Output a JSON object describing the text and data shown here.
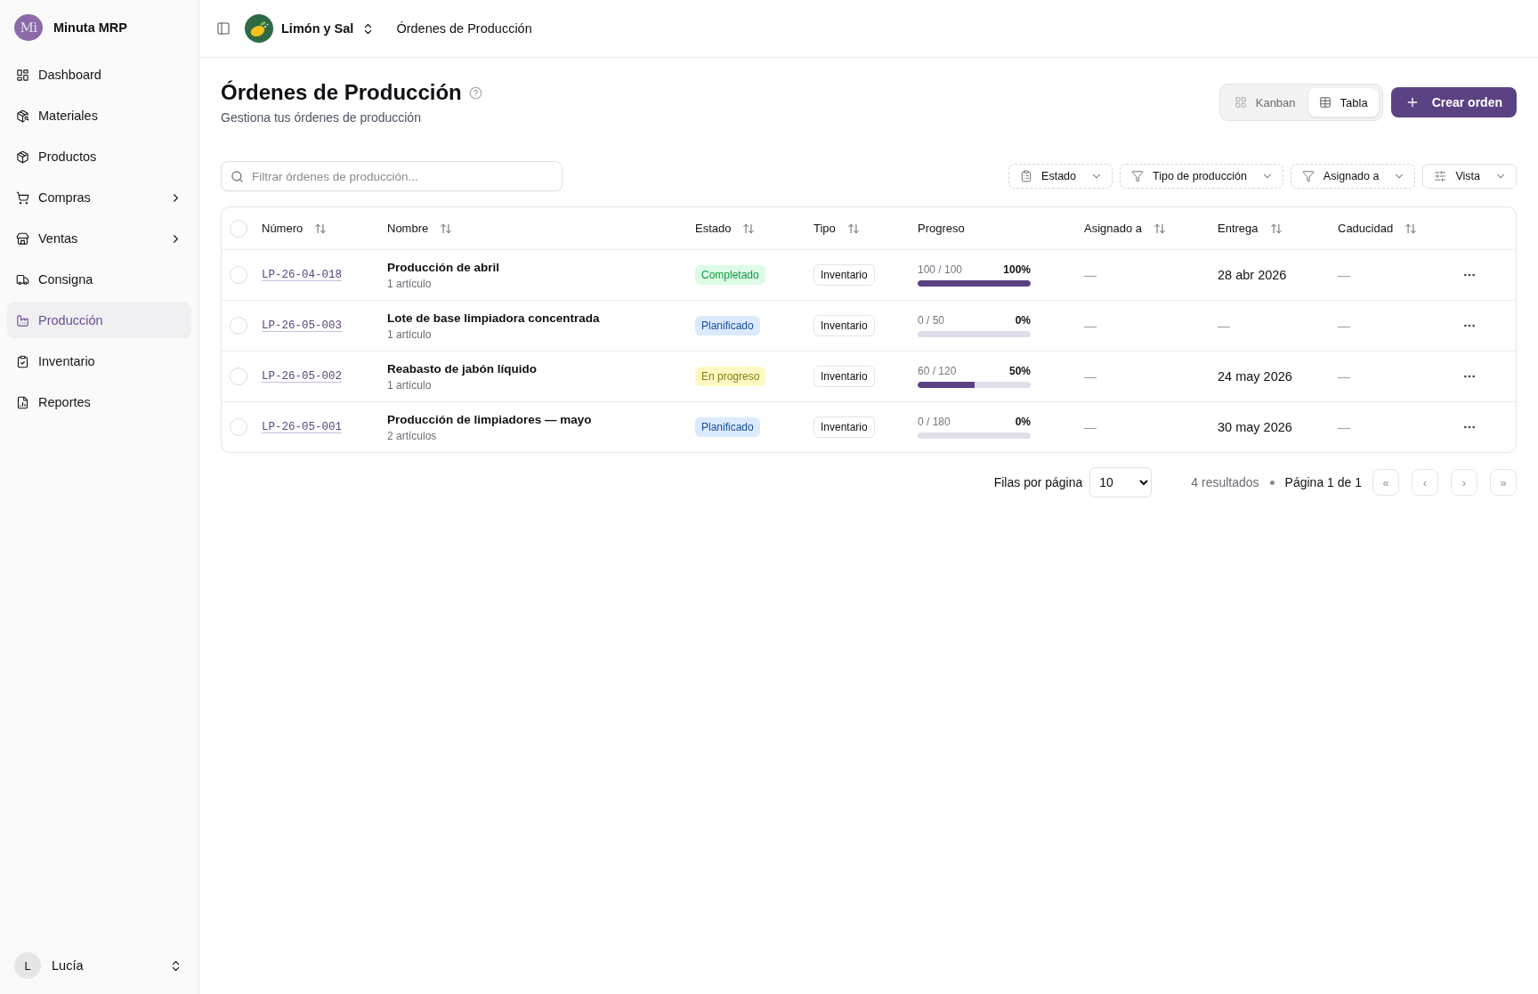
{
  "sidebar": {
    "app": {
      "logo_text": "Mi",
      "name": "Minuta MRP"
    },
    "items": [
      {
        "label": "Dashboard",
        "selected": false,
        "has_submenu": false
      },
      {
        "label": "Materiales",
        "selected": false,
        "has_submenu": false
      },
      {
        "label": "Productos",
        "selected": false,
        "has_submenu": false
      },
      {
        "label": "Compras",
        "selected": false,
        "has_submenu": true
      },
      {
        "label": "Ventas",
        "selected": false,
        "has_submenu": true
      },
      {
        "label": "Consigna",
        "selected": false,
        "has_submenu": false
      },
      {
        "label": "Producción",
        "selected": true,
        "has_submenu": false
      },
      {
        "label": "Inventario",
        "selected": false,
        "has_submenu": false
      },
      {
        "label": "Reportes",
        "selected": false,
        "has_submenu": false
      }
    ],
    "user": {
      "initial": "L",
      "name": "Lucía"
    }
  },
  "header": {
    "org": {
      "name": "Limón y Sal"
    },
    "breadcrumb": "Órdenes de Producción"
  },
  "page": {
    "title": "Órdenes de Producción",
    "subtitle": "Gestiona tus órdenes de producción"
  },
  "view_toggle": [
    {
      "label": "Kanban",
      "selected": false
    },
    {
      "label": "Tabla",
      "selected": true
    }
  ],
  "create_button": {
    "label": "Crear orden"
  },
  "search": {
    "placeholder": "Filtrar órdenes de producción..."
  },
  "filters": [
    {
      "label": "Estado",
      "kind": "filter"
    },
    {
      "label": "Tipo de producción",
      "kind": "filter"
    },
    {
      "label": "Asignado a",
      "kind": "filter"
    },
    {
      "label": "Vista",
      "kind": "view"
    }
  ],
  "table": {
    "select_all_checked": false,
    "columns": [
      {
        "label": "Número",
        "sortable": true
      },
      {
        "label": "Nombre",
        "sortable": true
      },
      {
        "label": "Estado",
        "sortable": true
      },
      {
        "label": "Tipo",
        "sortable": true
      },
      {
        "label": "Progreso",
        "sortable": false
      },
      {
        "label": "Asignado a",
        "sortable": true
      },
      {
        "label": "Entrega",
        "sortable": true
      },
      {
        "label": "Caducidad",
        "sortable": true
      }
    ],
    "rows": [
      {
        "checked": false,
        "number": "LP-26-04-018",
        "name": "Producción de abril",
        "items": "1 artículo",
        "status": {
          "label": "Completado",
          "color": "#dcfce7"
        },
        "type": "Inventario",
        "progress": {
          "reading": "100 / 100",
          "percent": "100%",
          "level": 1
        },
        "assigned": "—",
        "delivery": "28 abr 2026",
        "expiry": "—"
      },
      {
        "checked": false,
        "number": "LP-26-05-003",
        "name": "Lote de base limpiadora concentrada",
        "items": "1 artículo",
        "status": {
          "label": "Planificado",
          "color": "#dbeafe"
        },
        "type": "Inventario",
        "progress": {
          "reading": "0 / 50",
          "percent": "0%",
          "level": 0
        },
        "assigned": "—",
        "delivery": "—",
        "expiry": "—"
      },
      {
        "checked": false,
        "number": "LP-26-05-002",
        "name": "Reabasto de jabón líquido",
        "items": "1 artículo",
        "status": {
          "label": "En progreso",
          "color": "#fef9c3"
        },
        "type": "Inventario",
        "progress": {
          "reading": "60 / 120",
          "percent": "50%",
          "level": 0.5
        },
        "assigned": "—",
        "delivery": "24 may 2026",
        "expiry": "—"
      },
      {
        "checked": false,
        "number": "LP-26-05-001",
        "name": "Producción de limpiadores — mayo",
        "items": "2 artículos",
        "status": {
          "label": "Planificado",
          "color": "#dbeafe"
        },
        "type": "Inventario",
        "progress": {
          "reading": "0 / 180",
          "percent": "0%",
          "level": 0
        },
        "assigned": "—",
        "delivery": "30 may 2026",
        "expiry": "—"
      }
    ]
  },
  "pagination": {
    "rows_label": "Filas por página",
    "rows_value": "10",
    "results": "4 resultados",
    "page": "Página 1 de 1",
    "nav": [
      {
        "label": "«",
        "disabled": true
      },
      {
        "label": "‹",
        "disabled": true
      },
      {
        "label": "›",
        "disabled": true
      },
      {
        "label": "»",
        "disabled": true
      }
    ]
  }
}
